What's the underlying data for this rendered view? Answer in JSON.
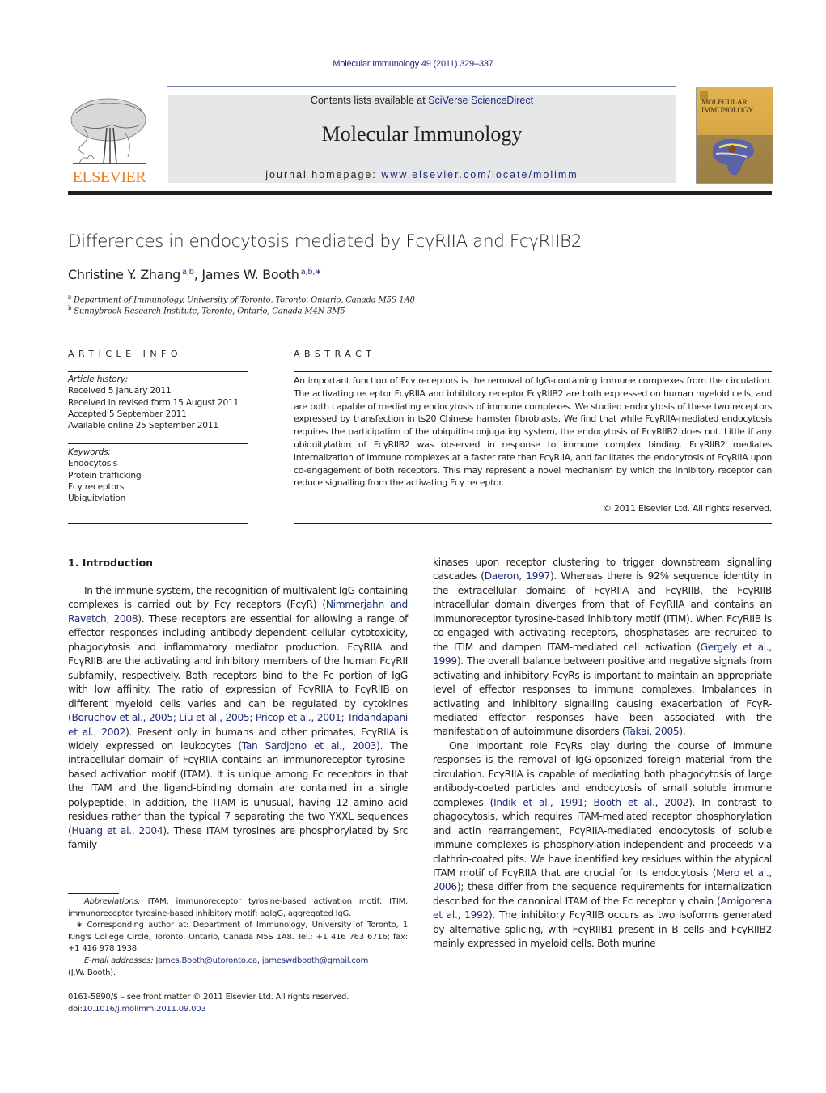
{
  "header": {
    "journal_ref": "Molecular Immunology 49 (2011) 329–337",
    "contents_prefix": "Contents lists available at ",
    "contents_link": "SciVerse ScienceDirect",
    "journal_title": "Molecular Immunology",
    "homepage_prefix": "journal homepage: ",
    "homepage_link": "www.elsevier.com/locate/molimm",
    "publisher_logo_text": "ELSEVIER",
    "cover_title_line1": "MOLECULAR",
    "cover_title_line2": "IMMUNOLOGY",
    "colors": {
      "link": "#1e2b7a",
      "elsevier_orange": "#f07f1c",
      "banner_bg": "#e6e7e8"
    }
  },
  "article": {
    "title": "Differences in endocytosis mediated by FcγRIIA and FcγRIIB2",
    "authors": [
      {
        "name": "Christine Y. Zhang",
        "affil": "a,b"
      },
      {
        "name": "James W. Booth",
        "affil": "a,b,∗"
      }
    ],
    "affiliations": [
      {
        "key": "a",
        "text": "Department of Immunology, University of Toronto, Toronto, Ontario, Canada M5S 1A8"
      },
      {
        "key": "b",
        "text": "Sunnybrook Research Institute, Toronto, Ontario, Canada M4N 3M5"
      }
    ]
  },
  "article_info": {
    "heading": "ARTICLE INFO",
    "history_label": "Article history:",
    "history": [
      "Received 5 January 2011",
      "Received in revised form 15 August 2011",
      "Accepted 5 September 2011",
      "Available online 25 September 2011"
    ],
    "keywords_label": "Keywords:",
    "keywords": [
      "Endocytosis",
      "Protein trafficking",
      "Fcγ receptors",
      "Ubiquitylation"
    ]
  },
  "abstract": {
    "heading": "ABSTRACT",
    "text": "An important function of Fcγ receptors is the removal of IgG-containing immune complexes from the circulation. The activating receptor FcγRIIA and inhibitory receptor FcγRIIB2 are both expressed on human myeloid cells, and are both capable of mediating endocytosis of immune complexes. We studied endocytosis of these two receptors expressed by transfection in ts20 Chinese hamster fibroblasts. We find that while FcγRIIA-mediated endocytosis requires the participation of the ubiquitin-conjugating system, the endocytosis of FcγRIIB2 does not. Little if any ubiquitylation of FcγRIIB2 was observed in response to immune complex binding. FcγRIIB2 mediates internalization of immune complexes at a faster rate than FcγRIIA, and facilitates the endocytosis of FcγRIIA upon co-engagement of both receptors. This may represent a novel mechanism by which the inhibitory receptor can reduce signalling from the activating Fcγ receptor.",
    "copyright": "© 2011 Elsevier Ltd. All rights reserved."
  },
  "intro": {
    "heading": "1.  Introduction",
    "col1_p1": [
      {
        "t": "In the immune system, the recognition of multivalent IgG-containing complexes is carried out by Fcγ receptors (FcγR) ("
      },
      {
        "t": "Nimmerjahn and Ravetch, 2008",
        "link": true
      },
      {
        "t": "). These receptors are essential for allowing a range of effector responses including antibody-dependent cellular cytotoxicity, phagocytosis and inflammatory mediator production. FcγRIIA and FcγRIIB are the activating and inhibitory members of the human FcγRII subfamily, respectively. Both receptors bind to the Fc portion of IgG with low affinity. The ratio of expression of FcγRIIA to FcγRIIB on different myeloid cells varies and can be regulated by cytokines ("
      },
      {
        "t": "Boruchov et al., 2005; Liu et al., 2005; Pricop et al., 2001; Tridandapani et al., 2002",
        "link": true
      },
      {
        "t": "). Present only in humans and other primates, FcγRIIA is widely expressed on leukocytes ("
      },
      {
        "t": "Tan Sardjono et al., 2003",
        "link": true
      },
      {
        "t": "). The intracellular domain of FcγRIIA contains an immunoreceptor tyrosine-based activation motif (ITAM). It is unique among Fc receptors in that the ITAM and the ligand-binding domain are contained in a single polypeptide. In addition, the ITAM is unusual, having 12 amino acid residues rather than the typical 7 separating the two YXXL sequences ("
      },
      {
        "t": "Huang et al., 2004",
        "link": true
      },
      {
        "t": "). These ITAM tyrosines are phosphorylated by Src family"
      }
    ],
    "col2_p1": [
      {
        "t": "kinases upon receptor clustering to trigger downstream signalling cascades ("
      },
      {
        "t": "Daeron, 1997",
        "link": true
      },
      {
        "t": "). Whereas there is 92% sequence identity in the extracellular domains of FcγRIIA and FcγRIIB, the FcγRIIB intracellular domain diverges from that of FcγRIIA and contains an immunoreceptor tyrosine-based inhibitory motif (ITIM). When FcγRIIB is co-engaged with activating receptors, phosphatases are recruited to the ITIM and dampen ITAM-mediated cell activation ("
      },
      {
        "t": "Gergely et al., 1999",
        "link": true
      },
      {
        "t": "). The overall balance between positive and negative signals from activating and inhibitory FcγRs is important to maintain an appropriate level of effector responses to immune complexes. Imbalances in activating and inhibitory signalling causing exacerbation of FcγR-mediated effector responses have been associated with the manifestation of autoimmune disorders ("
      },
      {
        "t": "Takai, 2005",
        "link": true
      },
      {
        "t": ")."
      }
    ],
    "col2_p2": [
      {
        "t": "One important role FcγRs play during the course of immune responses is the removal of IgG-opsonized foreign material from the circulation. FcγRIIA is capable of mediating both phagocytosis of large antibody-coated particles and endocytosis of small soluble immune complexes ("
      },
      {
        "t": "Indik et al., 1991; Booth et al., 2002",
        "link": true
      },
      {
        "t": "). In contrast to phagocytosis, which requires ITAM-mediated receptor phosphorylation and actin rearrangement, FcγRIIA-mediated endocytosis of soluble immune complexes is phosphorylation-independent and proceeds via clathrin-coated pits. We have identified key residues within the atypical ITAM motif of FcγRIIA that are crucial for its endocytosis ("
      },
      {
        "t": "Mero et al., 2006",
        "link": true
      },
      {
        "t": "); these differ from the sequence requirements for internalization described for the canonical ITAM of the Fc receptor γ chain ("
      },
      {
        "t": "Amigorena et al., 1992",
        "link": true
      },
      {
        "t": "). The inhibitory FcγRIIB occurs as two isoforms generated by alternative splicing, with FcγRIIB1 present in B cells and FcγRIIB2 mainly expressed in myeloid cells. Both murine"
      }
    ]
  },
  "footnotes": {
    "abbrev_label": "Abbreviations:",
    "abbrev_text": " ITAM, immunoreceptor tyrosine-based activation motif; ITIM, immunoreceptor tyrosine-based inhibitory motif; agIgG, aggregated IgG.",
    "corresponding": "∗ Corresponding author at: Department of Immunology, University of Toronto, 1 King's College Circle, Toronto, Ontario, Canada M5S 1A8. Tel.: +1 416 763 6716; fax: +1 416 978 1938.",
    "email_label": "E-mail addresses:",
    "email_1": "James.Booth@utoronto.ca",
    "email_2": "jameswdbooth@gmail.com",
    "email_suffix": "(J.W. Booth).",
    "front_matter": "0161-5890/$ – see front matter © 2011 Elsevier Ltd. All rights reserved.",
    "doi_prefix": "doi:",
    "doi": "10.1016/j.molimm.2011.09.003"
  }
}
